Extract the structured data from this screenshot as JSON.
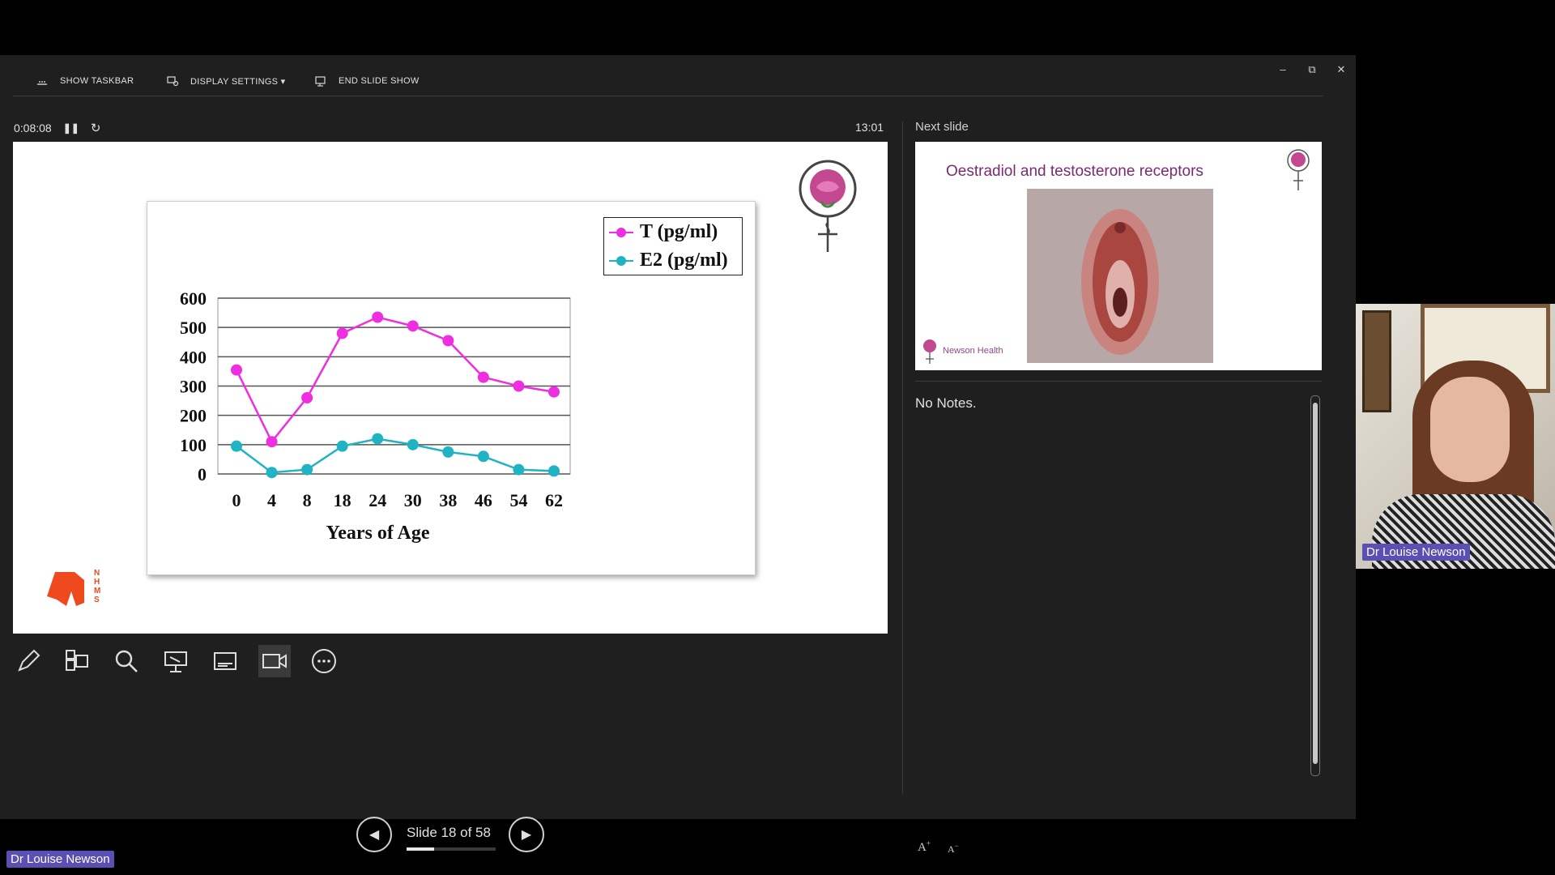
{
  "toolbar": {
    "show_taskbar": "SHOW TASKBAR",
    "display_settings": "DISPLAY SETTINGS ▾",
    "end_slide_show": "END SLIDE SHOW"
  },
  "window": {
    "minimize": "–",
    "restore": "⧉",
    "close": "✕"
  },
  "timer": {
    "elapsed": "0:08:08",
    "clock": "13:01"
  },
  "current_slide": {
    "logo_letters": [
      "N",
      "H",
      "M",
      "S"
    ],
    "chart_data": {
      "type": "line",
      "categories": [
        "0",
        "4",
        "8",
        "18",
        "24",
        "30",
        "38",
        "46",
        "54",
        "62"
      ],
      "series": [
        {
          "name": "T (pg/ml)",
          "color": "#ee2ee0",
          "values": [
            355,
            110,
            260,
            480,
            535,
            505,
            455,
            330,
            300,
            280
          ]
        },
        {
          "name": "E2 (pg/ml)",
          "color": "#1fb3c4",
          "values": [
            95,
            5,
            15,
            95,
            120,
            100,
            75,
            60,
            15,
            10
          ]
        }
      ],
      "yticks": [
        "600",
        "500",
        "400",
        "300",
        "200",
        "100",
        "0"
      ],
      "ylim": [
        0,
        600
      ],
      "xlabel": "Years of Age",
      "ylabel": "",
      "grid": true,
      "legend_position": "top-right"
    }
  },
  "next_slide": {
    "label": "Next slide",
    "title": "Oestradiol and testosterone receptors",
    "brand": "Newson Health"
  },
  "notes": {
    "text": "No Notes."
  },
  "tools": [
    "pen-tool",
    "see-all-slides",
    "zoom",
    "pointer-options",
    "subtitles",
    "camera",
    "more-options"
  ],
  "navigation": {
    "slide_counter": "Slide 18 of 58",
    "progress": 0.31
  },
  "font_controls": {
    "increase": "A",
    "decrease": "A"
  },
  "participant": {
    "name": "Dr Louise Newson"
  },
  "meeting_name_tag": "Dr Louise Newson"
}
